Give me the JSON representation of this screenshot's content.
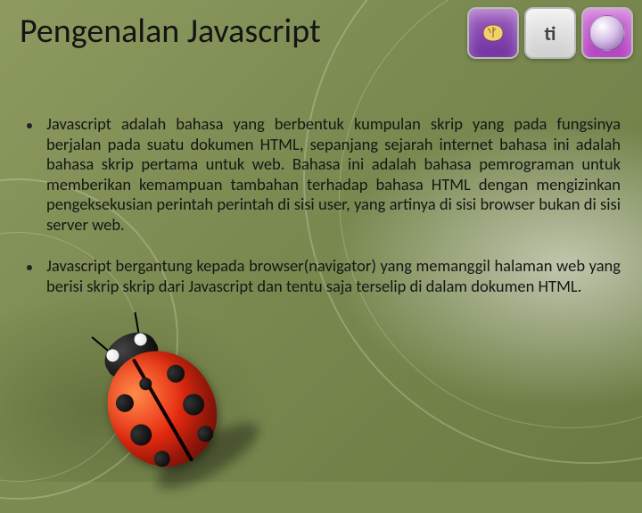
{
  "title": "Pengenalan Javascript",
  "logos": {
    "mid_text": "ti"
  },
  "bullets": [
    "Javascript adalah bahasa yang berbentuk kumpulan skrip yang pada fungsinya berjalan pada suatu dokumen HTML, sepanjang sejarah internet bahasa ini adalah bahasa skrip pertama untuk web. Bahasa ini adalah bahasa pemrograman untuk memberikan kemampuan tambahan terhadap bahasa HTML dengan mengizinkan pengeksekusian perintah perintah di sisi user, yang artinya di sisi browser bukan di sisi server web.",
    "Javascript bergantung kepada browser(navigator) yang memanggil halaman web yang berisi skrip skrip dari Javascript dan tentu saja terselip di dalam dokumen HTML."
  ]
}
